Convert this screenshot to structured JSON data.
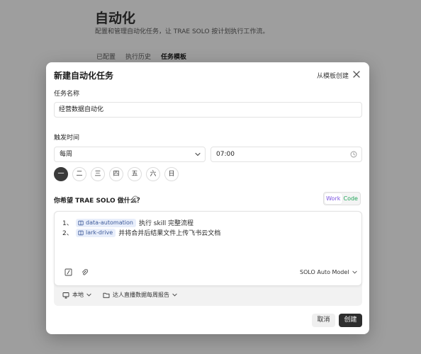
{
  "background": {
    "title": "自动化",
    "subtitle": "配置和管理自动化任务，让 TRAE SOLO 按计划执行工作流。",
    "tabs": [
      {
        "label": "已配置",
        "active": false
      },
      {
        "label": "执行历史",
        "active": false
      },
      {
        "label": "任务模板",
        "active": true
      }
    ]
  },
  "modal": {
    "title": "新建自动化任务",
    "from_template": "从模板创建",
    "close_icon": "close-icon",
    "name_label": "任务名称",
    "name_value": "经营数据自动化",
    "trigger_label": "触发时间",
    "frequency": "每周",
    "time": "07:00",
    "days": [
      {
        "label": "一",
        "active": true
      },
      {
        "label": "二",
        "active": false
      },
      {
        "label": "三",
        "active": false
      },
      {
        "label": "四",
        "active": false
      },
      {
        "label": "五",
        "active": false
      },
      {
        "label": "六",
        "active": false
      },
      {
        "label": "日",
        "active": false
      }
    ],
    "prompt_label": "你希望 TRAE SOLO 做什么？",
    "mode": {
      "work": "Work",
      "code": "Code",
      "selected": "Work"
    },
    "lines": [
      {
        "num": "1、",
        "chip": "data-automation",
        "text": "执行 skill 完整流程"
      },
      {
        "num": "2、",
        "chip": "lark-drive",
        "text": "并将合并后结果文件上传飞书云文档"
      }
    ],
    "model": "SOLO Auto Model",
    "location": "本地",
    "folder": "达人直播数据每周报告",
    "cancel": "取消",
    "create": "创建",
    "colors": {
      "work": "#7b53e0",
      "code": "#22a55a",
      "primary": "#2e2e2e",
      "chip_bg": "#e8eefb"
    }
  }
}
